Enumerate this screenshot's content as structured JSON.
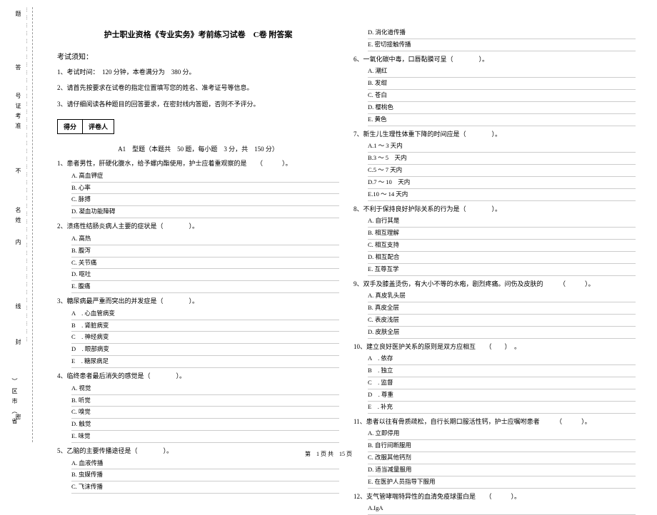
{
  "margin": {
    "vt1": "题",
    "vt2": "答",
    "vt3": "号证考准",
    "vt4": "不",
    "vt5": "名姓",
    "vt6": "内",
    "vt7": "线",
    "vt8": "封",
    "vt9": "）区市（省",
    "vt10": "密",
    "dots": "…………………………………………………………………………………………………………………"
  },
  "title": "护士职业资格《专业实务》考前练习试卷　C卷 附答案",
  "exam_notice": "考试须知：",
  "inst1": "1、考试时间：　120 分钟，本卷满分为　380 分。",
  "inst2": "2、请首先按要求在试卷的指定位置填写您的姓名、准考证号等信息。",
  "inst3": "3、请仔细阅读各种题目的回答要求，在密封线内答题，否则不予评分。",
  "score_a": "得分",
  "score_b": "评卷人",
  "part_title": "A1　型题（本题共　50 题，每小题　3 分，共　150 分）",
  "q1": {
    "stem": "1、患者男性，肝硬化腹水，给予螺内酯使用，护士应着重观察的是　　（　　　）。",
    "a": "A. 高血钾症",
    "b": "B. 心率",
    "c": "C. 脉搏",
    "d": "D. 凝血功能障碍"
  },
  "q2": {
    "stem": "2、溃疡性结肠炎病人主要的症状是（　　　　）。",
    "a": "A. 高热",
    "b": "B. 腹泻",
    "c": "C. 关节痛",
    "d": "D. 呕吐",
    "e": "E. 腹痛"
  },
  "q3": {
    "stem": "3、糖尿病最严重而突出的并发症是（　　　　）。",
    "a": "A　. 心血管病变",
    "b": "B　. 肾脏病变",
    "c": "C　. 神经病变",
    "d": "D　. 眼部病变",
    "e": "E　. 糖尿病足"
  },
  "q4": {
    "stem": "4、临终患者最后消失的感觉是（　　　　）。",
    "a": "A. 视觉",
    "b": "B. 听觉",
    "c": "C. 嗅觉",
    "d": "D. 触觉",
    "e": "E. 味觉"
  },
  "q5": {
    "stem": "5、乙脑的主要传播途径是（　　　　）。",
    "a": "A. 血液传播",
    "b": "B. 虫媒传播",
    "c": "C. 飞沫传播",
    "d": "D. 消化道传播",
    "e": "E. 密切接触传播"
  },
  "q6": {
    "stem": "6、一氧化碳中毒，口唇黏膜可呈（　　　　）。",
    "a": "A. 潮红",
    "b": "B. 发绀",
    "c": "C. 苍白",
    "d": "D. 樱桃色",
    "e": "E. 黄色"
  },
  "q7": {
    "stem": "7、新生儿生理性体重下降的时间应是（　　　　）。",
    "a": "A.1 ～ 3 天内",
    "b": "B.3 ～ 5　天内",
    "c": "C.5 ～ 7 天内",
    "d": "D.7 ～ 10　天内",
    "e": "E.10 ～ 14 天内"
  },
  "q8": {
    "stem": "8、不利于保持良好护际关系的行为是（　　　　）。",
    "a": "A. 自行其是",
    "b": "B. 相互理解",
    "c": "C. 相互支持",
    "d": "D. 相互配合",
    "e": "E. 互尊互学"
  },
  "q9": {
    "stem": "9、双手及膝盖烫伤，有大小不等的水疱，剧烈疼痛。问伤及皮肤的　　　（　　　）。",
    "a": "A. 真皮乳头层",
    "b": "B. 真皮全层",
    "c": "C. 表皮浅层",
    "d": "D. 皮肤全层"
  },
  "q10": {
    "stem": "10、建立良好医护关系的原则是双方应相互　　（　　）　。",
    "a": "A　. 依存",
    "b": "B　. 独立",
    "c": "C　. 监督",
    "d": "D　. 尊重",
    "e": "E　. 补充"
  },
  "q11": {
    "stem": "11、患者以往有骨质疏松，自行长期口服活性钙，护士应嘱咐患者　　　（　　　）。",
    "a": "A. 立即停用",
    "b": "B. 自行间断服用",
    "c": "C. 改服其他钙剂",
    "d": "D. 适当减量服用",
    "e": "E. 在医护人员指导下服用"
  },
  "q12": {
    "stem": "12、支气管哮喘特异性的血清免疫球蛋白是　　（　　　）。",
    "a": "A.IgA"
  },
  "footer": "第　1 页 共　15 页"
}
